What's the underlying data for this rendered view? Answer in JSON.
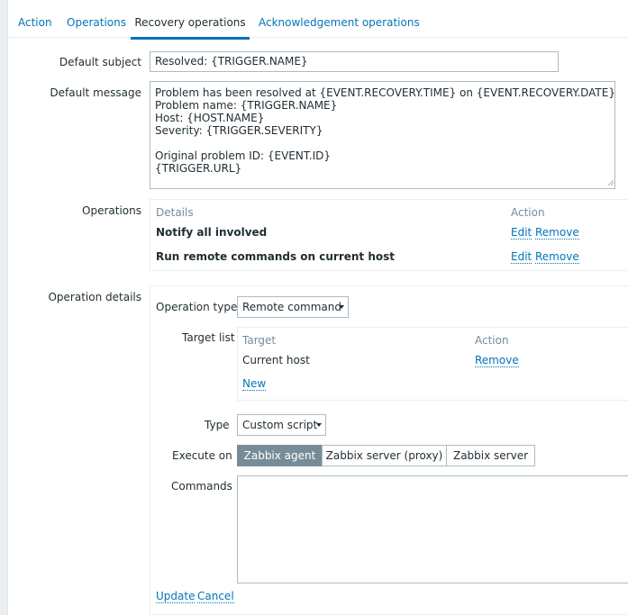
{
  "tabs": [
    "Action",
    "Operations",
    "Recovery operations",
    "Acknowledgement operations"
  ],
  "labels": {
    "default_subject": "Default subject",
    "default_message": "Default message",
    "operations": "Operations",
    "operation_details": "Operation details",
    "operation_type": "Operation type",
    "target_list": "Target list",
    "type": "Type",
    "execute_on": "Execute on",
    "commands": "Commands"
  },
  "subject_value": "Resolved: {TRIGGER.NAME}",
  "message_value": "Problem has been resolved at {EVENT.RECOVERY.TIME} on {EVENT.RECOVERY.DATE}\nProblem name: {TRIGGER.NAME}\nHost: {HOST.NAME}\nSeverity: {TRIGGER.SEVERITY}\n\nOriginal problem ID: {EVENT.ID}\n{TRIGGER.URL}",
  "operations_table": {
    "col_details": "Details",
    "col_action": "Action",
    "rows": [
      {
        "details": "Notify all involved",
        "edit": "Edit",
        "remove": "Remove"
      },
      {
        "details": "Run remote commands on current host",
        "edit": "Edit",
        "remove": "Remove"
      }
    ]
  },
  "operation_type_value": "Remote command",
  "target_table": {
    "col_target": "Target",
    "col_action": "Action",
    "row_target": "Current host",
    "row_remove": "Remove",
    "new_link": "New"
  },
  "type_value": "Custom script",
  "execute_on_options": [
    "Zabbix agent",
    "Zabbix server (proxy)",
    "Zabbix server"
  ],
  "execute_on_selected": "Zabbix agent",
  "commands_value": "",
  "footer": {
    "update": "Update",
    "cancel": "Cancel"
  },
  "colors": {
    "accent": "#0275b8",
    "selected_segment": "#768d99"
  }
}
